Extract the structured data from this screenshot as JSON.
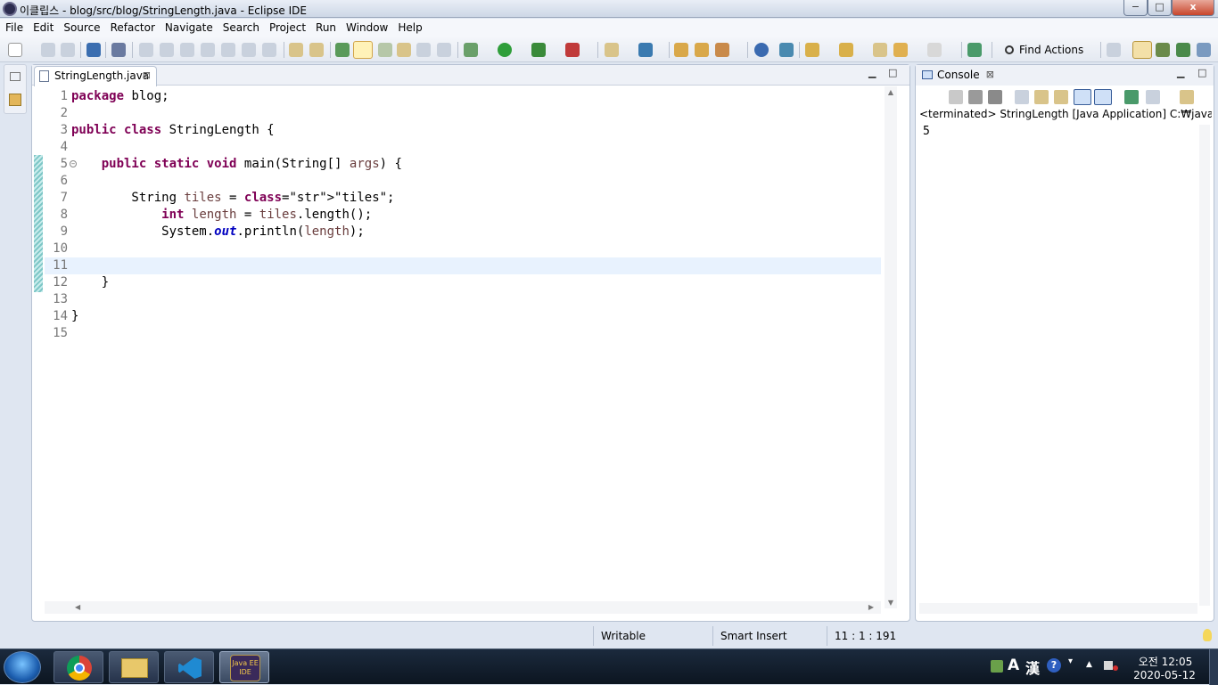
{
  "window": {
    "title": "이클립스 - blog/src/blog/StringLength.java - Eclipse IDE",
    "minimize": "−",
    "maximize": "□",
    "close": "x"
  },
  "menu": [
    "File",
    "Edit",
    "Source",
    "Refactor",
    "Navigate",
    "Search",
    "Project",
    "Run",
    "Window",
    "Help"
  ],
  "toolbar": {
    "find_actions": "Find Actions"
  },
  "editor": {
    "tab_label": "StringLength.java",
    "current_line": 11,
    "lines": [
      {
        "n": "1",
        "text": "package blog;"
      },
      {
        "n": "2",
        "text": ""
      },
      {
        "n": "3",
        "text": "public class StringLength {"
      },
      {
        "n": "4",
        "text": ""
      },
      {
        "n": "5",
        "text": "    public static void main(String[] args) {"
      },
      {
        "n": "6",
        "text": ""
      },
      {
        "n": "7",
        "text": "        String tiles = \"tiles\";"
      },
      {
        "n": "8",
        "text": "            int length = tiles.length();"
      },
      {
        "n": "9",
        "text": "            System.out.println(length);"
      },
      {
        "n": "10",
        "text": ""
      },
      {
        "n": "11",
        "text": ""
      },
      {
        "n": "12",
        "text": "    }"
      },
      {
        "n": "13",
        "text": ""
      },
      {
        "n": "14",
        "text": "}"
      },
      {
        "n": "15",
        "text": ""
      }
    ]
  },
  "console": {
    "tab_label": "Console",
    "status": "<terminated> StringLength [Java Application] C:₩java₩bin₩ja",
    "output": "5"
  },
  "statusbar": {
    "writable": "Writable",
    "insert_mode": "Smart Insert",
    "position": "11 : 1 : 191"
  },
  "taskbar": {
    "time": "오전 12:05",
    "date": "2020-05-12",
    "ime_a": "A",
    "ime_han": "漢",
    "java_ee_label": "Java EE IDE"
  },
  "colors": {
    "keyword": "#7f0055",
    "string": "#2a00ff",
    "field": "#0000c0",
    "local_var": "#6a3e3e",
    "current_line": "#e8f2fe"
  }
}
